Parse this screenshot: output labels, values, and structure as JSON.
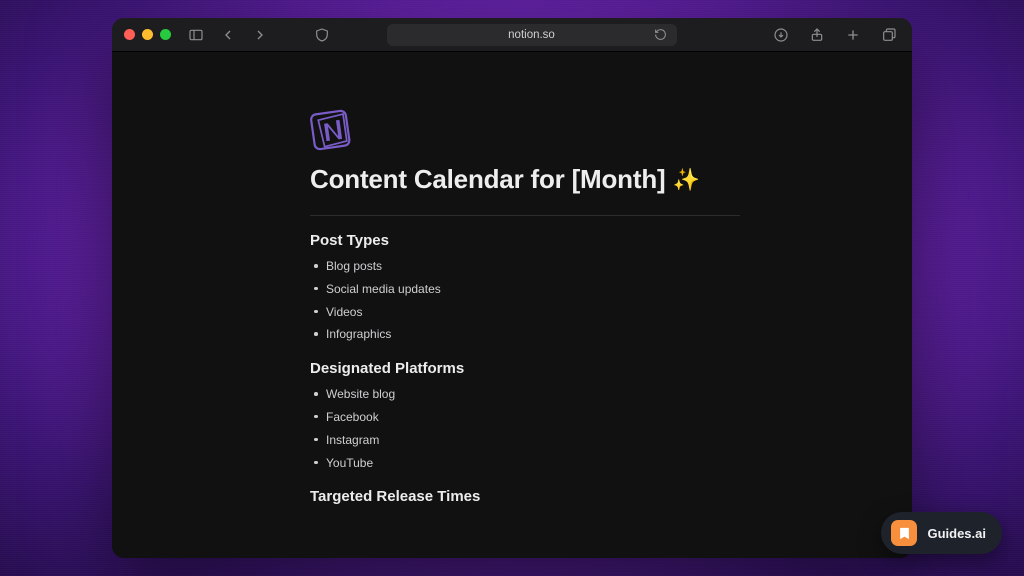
{
  "browser": {
    "url": "notion.so"
  },
  "page": {
    "title": "Content Calendar for [Month]",
    "sparkle": "✨"
  },
  "sections": {
    "postTypes": {
      "heading": "Post Types",
      "items": [
        "Blog posts",
        "Social media updates",
        "Videos",
        "Infographics"
      ]
    },
    "platforms": {
      "heading": "Designated Platforms",
      "items": [
        "Website blog",
        "Facebook",
        "Instagram",
        "YouTube"
      ]
    },
    "releaseTimes": {
      "heading": "Targeted Release Times"
    }
  },
  "watermark": {
    "label": "Guides.ai"
  },
  "colors": {
    "notionPurple": "#7a5cc9"
  }
}
